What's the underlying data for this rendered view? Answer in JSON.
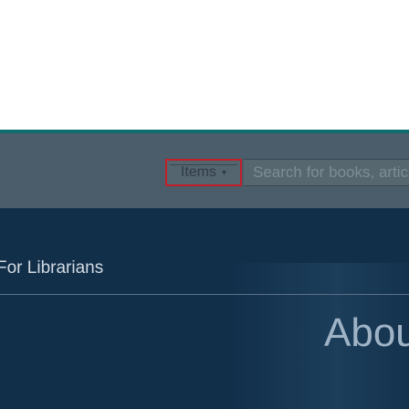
{
  "search": {
    "scope_label": "Items",
    "scope_caret": "▾",
    "placeholder": "Search for books, artic"
  },
  "nav": {
    "librarians_label": "For Librarians"
  },
  "hero": {
    "heading": "About"
  }
}
